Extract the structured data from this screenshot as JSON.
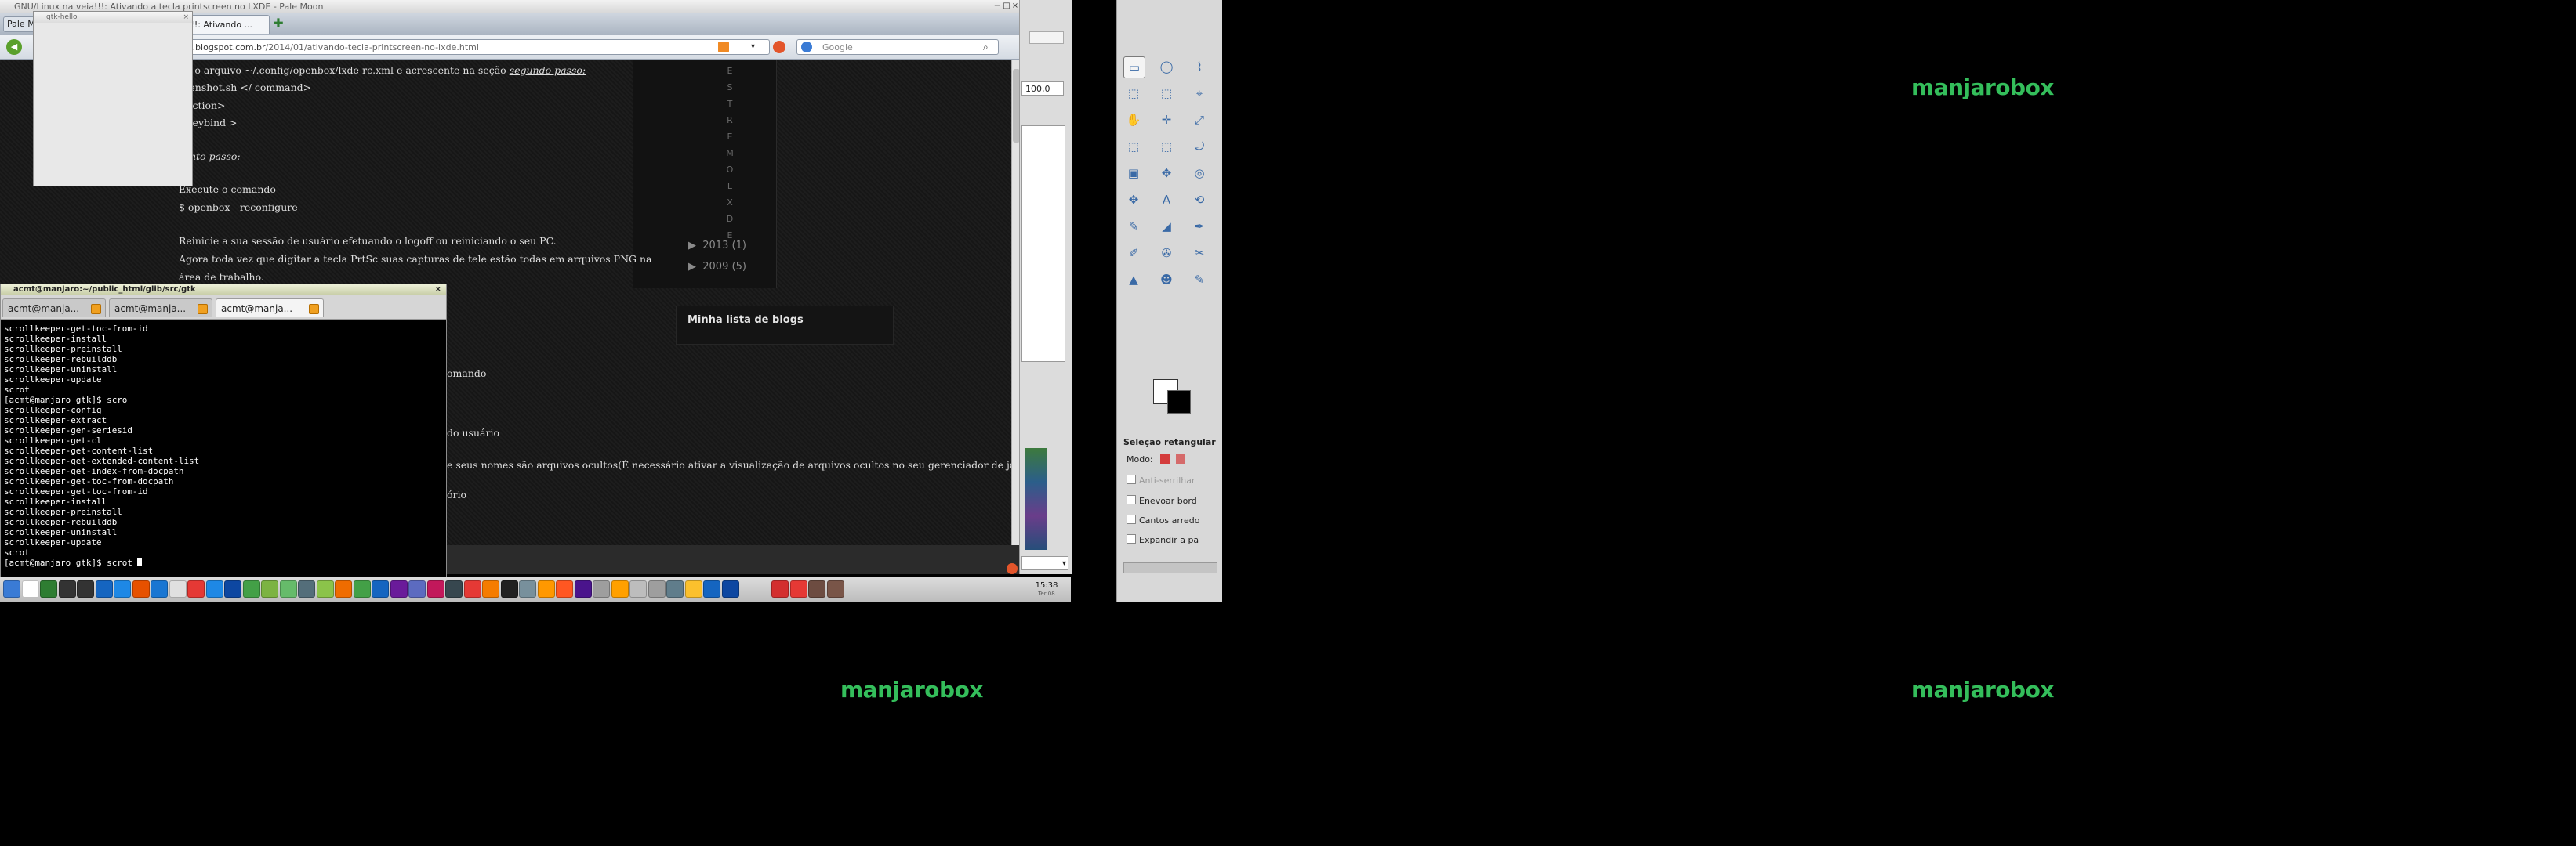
{
  "brand": {
    "text": "manjarobox"
  },
  "palemoon": {
    "title": "GNU/Linux na veia!!!: Ativando a tecla printscreen no LXDE - Pale Moon",
    "menu_label": "Pale M",
    "tab_label": "!!!: Ativando ...",
    "url_host": "ael.blogspot.com.br",
    "url_path": "/2014/01/ativando-tecla-printscreen-no-lxde.html",
    "search_placeholder": "Google",
    "post_lines": [
      "ite o arquivo ~/.config/openbox/lxde-rc.xml e acrescente na seção",
      "segundo passo:",
      "reenshot.sh </ command>",
      "action>",
      "keybind >",
      "into passo:",
      "Execute o comando",
      "$ openbox --reconfigure",
      "Reinicie a sua sessão de usuário efetuando o logoff ou reiniciando o seu PC.",
      "Agora toda vez que digitar a tecla PrtSc suas capturas de tele estão todas em arquivos PNG na",
      "área de trabalho.",
      "omando",
      "do usuário",
      "e seus nomes são arquivos ocultos(É necessário ativar a visualização de arquivos ocultos no seu gerenciador de janelas)",
      "ório"
    ],
    "sidebar_vertical": "E S T R E M O L X D E",
    "archive": [
      {
        "year": "2013",
        "count": "(1)"
      },
      {
        "year": "2009",
        "count": "(5)"
      }
    ],
    "blog_list_title": "Minha lista de blogs"
  },
  "gtk_hello": {
    "title": "gtk-hello"
  },
  "terminal": {
    "title": "acmt@manjaro:~/public_html/glib/src/gtk",
    "tabs": [
      "acmt@manja...",
      "acmt@manja...",
      "acmt@manja..."
    ],
    "lines": [
      "scrollkeeper-get-toc-from-id",
      "scrollkeeper-install",
      "scrollkeeper-preinstall",
      "scrollkeeper-rebuilddb",
      "scrollkeeper-uninstall",
      "scrollkeeper-update",
      "scrot",
      "[acmt@manjaro gtk]$ scro",
      "scrollkeeper-config",
      "scrollkeeper-extract",
      "scrollkeeper-gen-seriesid",
      "scrollkeeper-get-cl",
      "scrollkeeper-get-content-list",
      "scrollkeeper-get-extended-content-list",
      "scrollkeeper-get-index-from-docpath",
      "scrollkeeper-get-toc-from-docpath",
      "scrollkeeper-get-toc-from-id",
      "scrollkeeper-install",
      "scrollkeeper-preinstall",
      "scrollkeeper-rebuilddb",
      "scrollkeeper-uninstall",
      "scrollkeeper-update",
      "scrot"
    ],
    "prompt": "[acmt@manjaro gtk]$ scrot "
  },
  "gimp": {
    "zoom_value": "100,0",
    "tool_options_title": "Seleção retangular",
    "mode_label": "Modo:",
    "options": [
      "Anti-serrilhar",
      "Enevoar bord",
      "Cantos arredo",
      "Expandir a pa"
    ]
  },
  "clock": {
    "time": "15:38",
    "date": "Ter 08"
  },
  "colors": {
    "brand_green": "#34be5b",
    "terminal_bg": "#000000",
    "blog_bg": "#1b1b1b"
  }
}
